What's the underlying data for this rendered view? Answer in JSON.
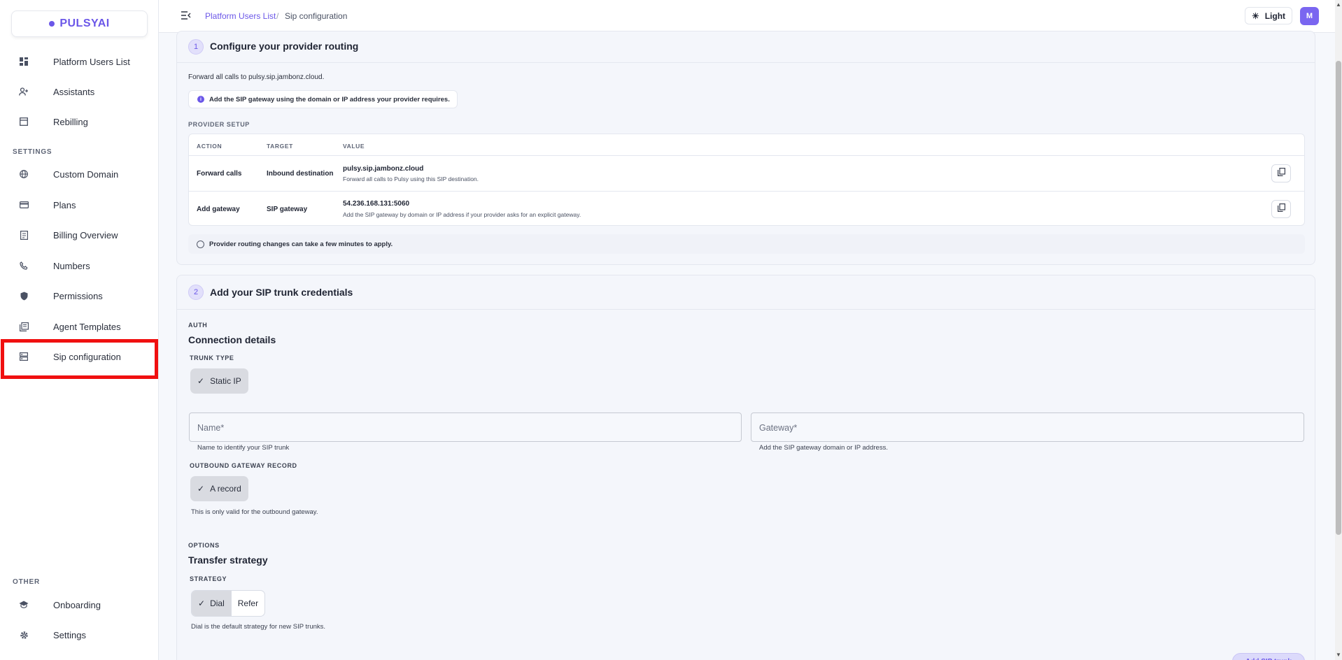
{
  "brand": {
    "name": "PULSYAI",
    "color": "#6b57e8"
  },
  "sidebar": {
    "main_items": [
      {
        "label": "Platform Users List",
        "icon": "dashboard-icon"
      },
      {
        "label": "Assistants",
        "icon": "person-add-icon"
      },
      {
        "label": "Rebilling",
        "icon": "store-icon"
      }
    ],
    "settings_label": "SETTINGS",
    "settings_items": [
      {
        "label": "Custom Domain",
        "icon": "globe-icon"
      },
      {
        "label": "Plans",
        "icon": "credit-card-icon"
      },
      {
        "label": "Billing Overview",
        "icon": "receipt-icon"
      },
      {
        "label": "Numbers",
        "icon": "phone-icon"
      },
      {
        "label": "Permissions",
        "icon": "shield-icon"
      },
      {
        "label": "Agent Templates",
        "icon": "library-icon"
      },
      {
        "label": "Sip configuration",
        "icon": "server-icon",
        "active": true
      }
    ],
    "other_label": "OTHER",
    "other_items": [
      {
        "label": "Onboarding",
        "icon": "school-icon"
      },
      {
        "label": "Settings",
        "icon": "gear-icon"
      }
    ]
  },
  "topbar": {
    "breadcrumb_parent": "Platform Users List",
    "breadcrumb_sep": "/",
    "breadcrumb_current": "Sip configuration",
    "theme_label": "Light",
    "avatar_initial": "M"
  },
  "step1": {
    "number": "1",
    "title": "Configure your provider routing",
    "forward_text": "Forward all calls to pulsy.sip.jambonz.cloud.",
    "info_text": "Add the SIP gateway using the domain or IP address your provider requires.",
    "provider_label": "PROVIDER SETUP",
    "table": {
      "headers": [
        "ACTION",
        "TARGET",
        "VALUE"
      ],
      "rows": [
        {
          "action": "Forward calls",
          "target": "Inbound destination",
          "value": "pulsy.sip.jambonz.cloud",
          "sub": "Forward all calls to Pulsy using this SIP destination."
        },
        {
          "action": "Add gateway",
          "target": "SIP gateway",
          "value": "54.236.168.131:5060",
          "sub": "Add the SIP gateway by domain or IP address if your provider asks for an explicit gateway."
        }
      ]
    },
    "note": "Provider routing changes can take a few minutes to apply."
  },
  "step2": {
    "number": "2",
    "title": "Add your SIP trunk credentials",
    "auth_label": "AUTH",
    "connection_title": "Connection details",
    "trunk_type_label": "TRUNK TYPE",
    "trunk_type_value": "Static IP",
    "name_placeholder": "Name*",
    "name_help": "Name to identify your SIP trunk",
    "gateway_placeholder": "Gateway*",
    "gateway_help": "Add the SIP gateway domain or IP address.",
    "outbound_label": "OUTBOUND GATEWAY RECORD",
    "outbound_value": "A record",
    "outbound_help": "This is only valid for the outbound gateway.",
    "options_label": "OPTIONS",
    "transfer_title": "Transfer strategy",
    "strategy_label": "STRATEGY",
    "strategy_options": [
      "Dial",
      "Refer"
    ],
    "strategy_help": "Dial is the default strategy for new SIP trunks.",
    "add_button": "Add SIP trunk"
  }
}
